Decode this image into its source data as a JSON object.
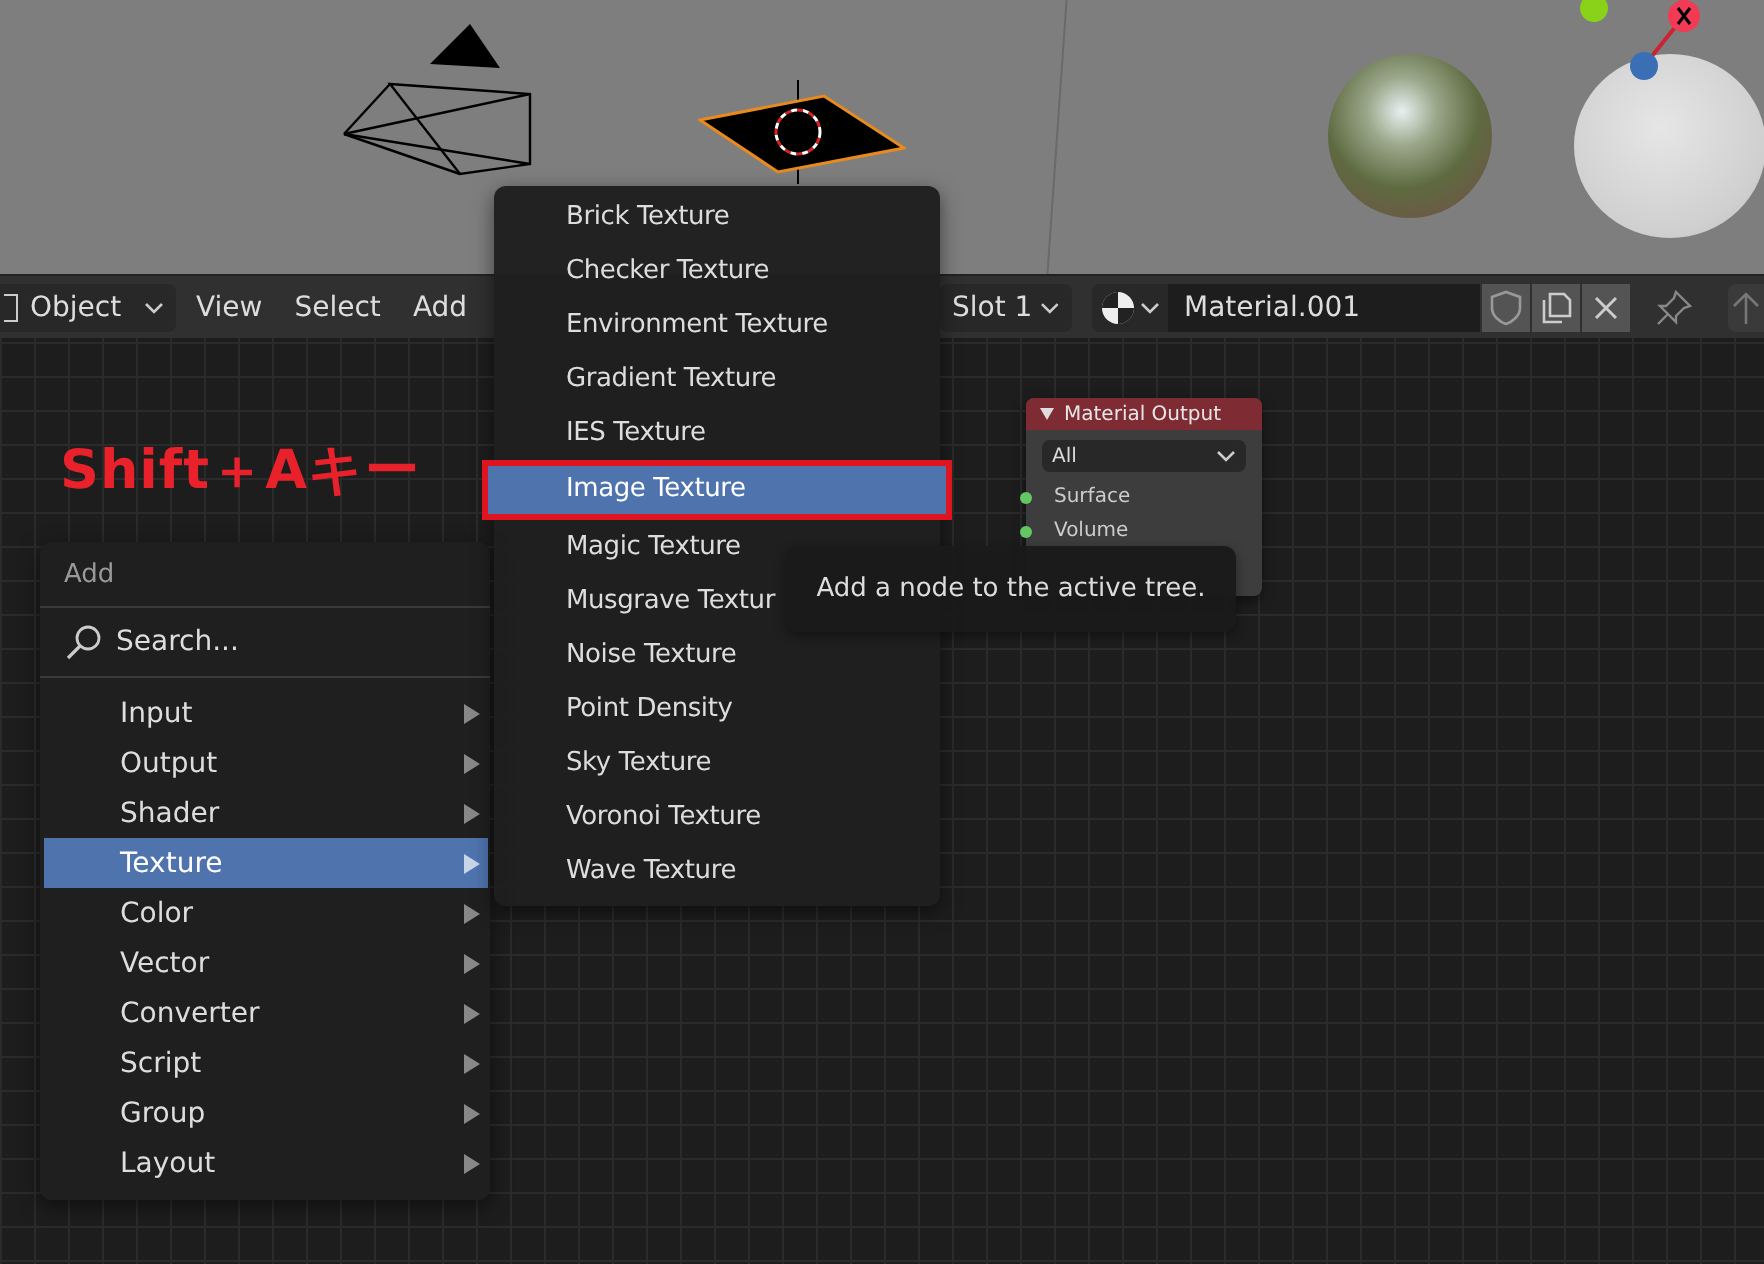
{
  "header": {
    "mode": "Object",
    "menus": [
      "View",
      "Select",
      "Add"
    ],
    "slot": "Slot 1",
    "material": "Material.001"
  },
  "annotation": "Shift＋Aキー",
  "node": {
    "title": "Material Output",
    "target": "All",
    "sockets": [
      {
        "label": "Surface",
        "color": "#63c763"
      },
      {
        "label": "Volume",
        "color": "#63c763"
      }
    ]
  },
  "add_menu": {
    "title": "Add",
    "search": {
      "label": "Search..."
    },
    "items": [
      {
        "label": "Input",
        "selected": false
      },
      {
        "label": "Output",
        "selected": false
      },
      {
        "label": "Shader",
        "selected": false
      },
      {
        "label": "Texture",
        "selected": true
      },
      {
        "label": "Color",
        "selected": false
      },
      {
        "label": "Vector",
        "selected": false
      },
      {
        "label": "Converter",
        "selected": false
      },
      {
        "label": "Script",
        "selected": false
      },
      {
        "label": "Group",
        "selected": false
      },
      {
        "label": "Layout",
        "selected": false
      }
    ]
  },
  "texture_menu": {
    "items": [
      {
        "label": "Brick Texture",
        "selected": false
      },
      {
        "label": "Checker Texture",
        "selected": false
      },
      {
        "label": "Environment Texture",
        "selected": false
      },
      {
        "label": "Gradient Texture",
        "selected": false
      },
      {
        "label": "IES Texture",
        "selected": false
      },
      {
        "label": "Image Texture",
        "selected": true
      },
      {
        "label": "Magic Texture",
        "selected": false
      },
      {
        "label": "Musgrave Textur",
        "selected": false
      },
      {
        "label": "Noise Texture",
        "selected": false
      },
      {
        "label": "Point Density",
        "selected": false
      },
      {
        "label": "Sky Texture",
        "selected": false
      },
      {
        "label": "Voronoi Texture",
        "selected": false
      },
      {
        "label": "Wave Texture",
        "selected": false
      }
    ]
  },
  "tooltip": "Add a node to the active tree."
}
